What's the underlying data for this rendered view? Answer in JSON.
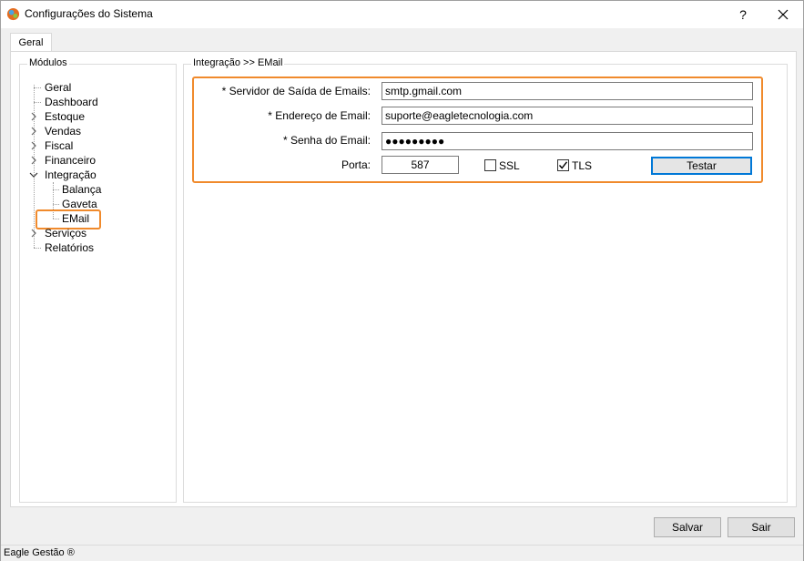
{
  "window": {
    "title": "Configurações do Sistema",
    "help_glyph": "?",
    "close_glyph": "✕"
  },
  "tabs": [
    {
      "label": "Geral",
      "selected": true
    }
  ],
  "modules": {
    "caption": "Módulos",
    "items": [
      {
        "label": "Geral",
        "expandable": false
      },
      {
        "label": "Dashboard",
        "expandable": false
      },
      {
        "label": "Estoque",
        "expandable": true
      },
      {
        "label": "Vendas",
        "expandable": true
      },
      {
        "label": "Fiscal",
        "expandable": true
      },
      {
        "label": "Financeiro",
        "expandable": true
      },
      {
        "label": "Integração",
        "expandable": true,
        "expanded": true,
        "children": [
          {
            "label": "Balança"
          },
          {
            "label": "Gaveta"
          },
          {
            "label": "EMail",
            "selected": true
          }
        ]
      },
      {
        "label": "Serviços",
        "expandable": true
      },
      {
        "label": "Relatórios",
        "expandable": false
      }
    ]
  },
  "email_config": {
    "caption": "Integração >> EMail",
    "server_label": "* Servidor de Saída de Emails:",
    "server_value": "smtp.gmail.com",
    "address_label": "* Endereço de Email:",
    "address_value": "suporte@eagletecnologia.com",
    "password_label": "* Senha do Email:",
    "password_value": "●●●●●●●●●",
    "port_label": "Porta:",
    "port_value": "587",
    "ssl_label": "SSL",
    "ssl_checked": false,
    "tls_label": "TLS",
    "tls_checked": true,
    "test_button": "Testar"
  },
  "footer": {
    "save_button": "Salvar",
    "exit_button": "Sair"
  },
  "status": {
    "text": "Eagle Gestão ®"
  },
  "colors": {
    "highlight": "#f08a2c",
    "focus_border": "#0078d7"
  }
}
